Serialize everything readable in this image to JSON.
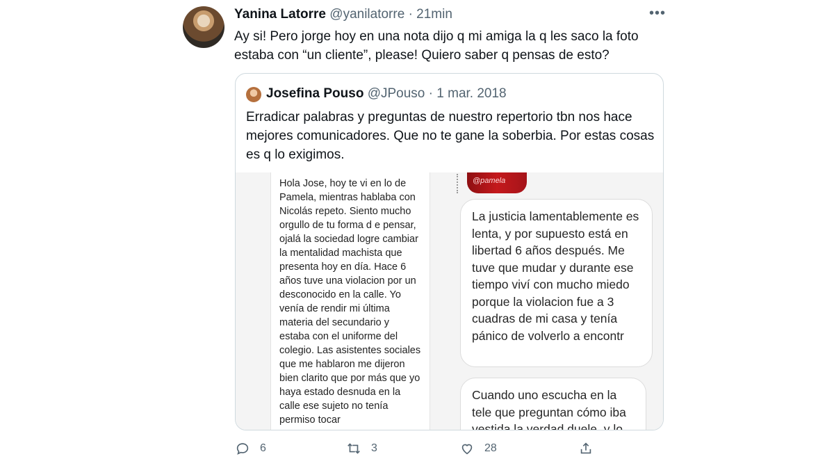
{
  "tweet": {
    "author_name": "Yanina Latorre",
    "handle": "@yanilatorre",
    "separator": "·",
    "time": "21min",
    "more": "•••",
    "text": "Ay si! Pero jorge hoy en una nota dijo q mi amiga la q les saco la foto estaba con “un cliente”, please! Quiero saber q pensas de esto?"
  },
  "quoted": {
    "author_name": "Josefina Pouso",
    "handle": "@JPouso",
    "separator": "·",
    "date": "1 mar. 2018",
    "text": "Erradicar palabras y preguntas de nuestro repertorio tbn nos hace mejores comunicadores. Que no te gane la soberbia. Por estas cosas es q lo exigimos.",
    "media": {
      "left_text": "Hola Jose, hoy te vi en lo de Pamela, mientras hablaba con Nicolás repeto. Siento mucho orgullo de tu forma d e pensar, ojalá la sociedad logre cambiar la mentalidad machista que presenta hoy en día. Hace 6 años tuve una violacion por un desconocido en la calle. Yo venía de rendir mi última materia del secundario y estaba con el uniforme del colegio. Las asistentes sociales que me hablaron me dijeron bien clarito que por más que yo haya estado desnuda en la calle ese sujeto no tenía permiso tocar",
      "sticker_text": "@pamela",
      "bubble1": "La justicia lamentablemente es lenta, y por supuesto está en libertad 6 años después. Me tuve que mudar y durante ese tiempo viví con mucho miedo porque la violacion fue a 3 cuadras de mi casa y tenía pánico de volverlo a encontr",
      "bubble2": "Cuando uno escucha en la tele que preguntan cómo iba vestida la verdad duele, y lo"
    }
  },
  "actions": {
    "reply_count": "6",
    "retweet_count": "3",
    "like_count": "28"
  },
  "icons": [
    "reply-icon",
    "retweet-icon",
    "like-icon",
    "share-icon",
    "more-icon"
  ]
}
